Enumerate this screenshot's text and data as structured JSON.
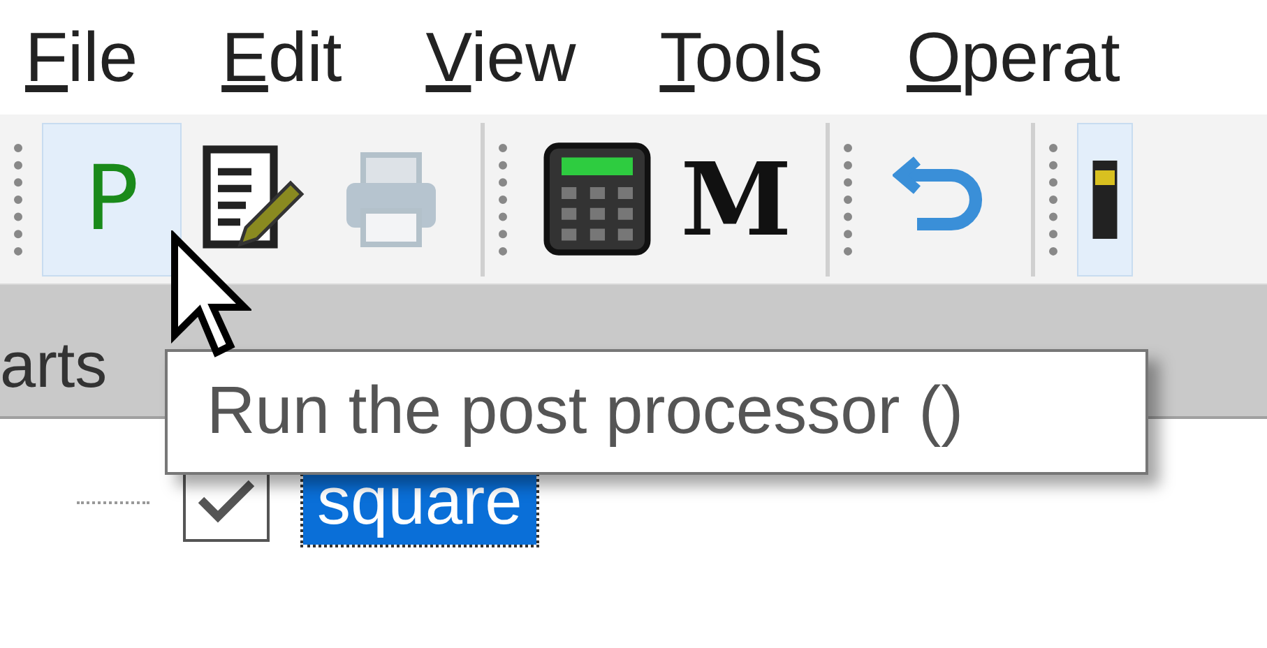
{
  "menu_bar": [
    {
      "label": "File"
    },
    {
      "label": "Edit"
    },
    {
      "label": "View"
    },
    {
      "label": "Tools"
    },
    {
      "label": "Operat"
    }
  ],
  "toolbar": [
    {
      "kind": "glyph",
      "glyph": "P",
      "hovered": true,
      "disabled": false
    },
    {
      "kind": "notepad",
      "hovered": false,
      "disabled": false
    },
    {
      "kind": "printer",
      "hovered": false,
      "disabled": true
    },
    {
      "kind": "separator"
    },
    {
      "kind": "calculator",
      "hovered": false,
      "disabled": false
    },
    {
      "kind": "glyph",
      "glyph": "M",
      "hovered": false,
      "disabled": false
    },
    {
      "kind": "separator"
    },
    {
      "kind": "undo",
      "hovered": false,
      "disabled": false
    },
    {
      "kind": "separator"
    },
    {
      "kind": "partial",
      "hovered": true,
      "disabled": false
    }
  ],
  "panel": {
    "tab": "arts"
  },
  "tree": [
    {
      "label": "square",
      "checked": true,
      "selected": true
    }
  ],
  "tooltip": {
    "text": "Run the post processor ()"
  }
}
